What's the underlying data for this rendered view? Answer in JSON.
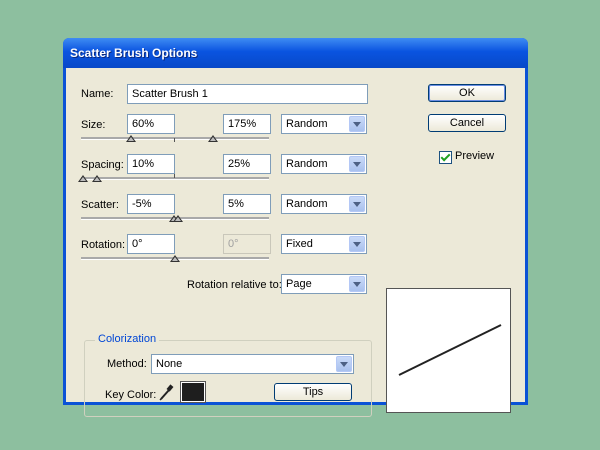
{
  "window": {
    "title": "Scatter Brush Options"
  },
  "name": {
    "label": "Name:",
    "value": "Scatter Brush 1"
  },
  "size": {
    "label": "Size:",
    "min_value": "60%",
    "max_value": "175%",
    "variation": "Random"
  },
  "spacing": {
    "label": "Spacing:",
    "min_value": "10%",
    "max_value": "25%",
    "variation": "Random"
  },
  "scatter": {
    "label": "Scatter:",
    "min_value": "-5%",
    "max_value": "5%",
    "variation": "Random"
  },
  "rotation": {
    "label": "Rotation:",
    "min_value": "0°",
    "max_value": "0°",
    "variation": "Fixed"
  },
  "rotation_relative": {
    "label": "Rotation relative to:",
    "value": "Page"
  },
  "colorization": {
    "group_title": "Colorization",
    "method_label": "Method:",
    "method_value": "None",
    "key_color_label": "Key Color:",
    "key_color": "#1e1e1e",
    "tips_label": "Tips"
  },
  "buttons": {
    "ok": "OK",
    "cancel": "Cancel"
  },
  "preview": {
    "label": "Preview",
    "checked": true
  },
  "colors": {
    "title_bar": "#0a54e0",
    "dialog_bg": "#ece9d8",
    "desktop_bg": "#8dbf9f"
  }
}
